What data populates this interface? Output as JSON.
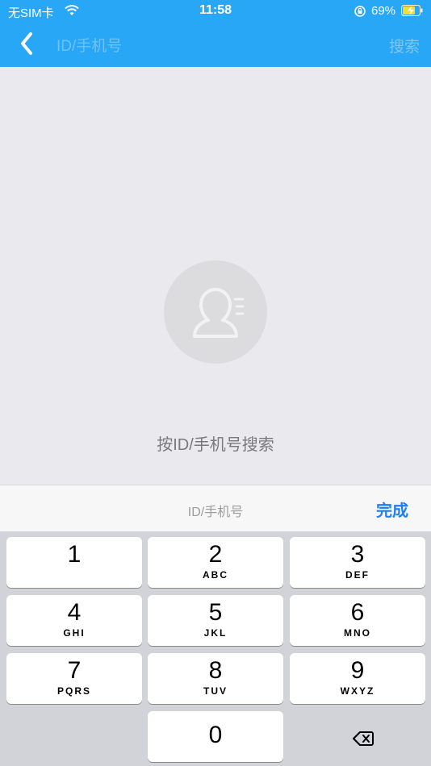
{
  "status_bar": {
    "carrier": "无SIM卡",
    "time": "11:58",
    "battery_percent": "69%"
  },
  "nav": {
    "search_placeholder": "ID/手机号",
    "search_button": "搜索"
  },
  "empty_state": {
    "hint": "按ID/手机号搜索"
  },
  "keyboard_accessory": {
    "placeholder": "ID/手机号",
    "done": "完成"
  },
  "keypad": {
    "keys": [
      {
        "num": "1",
        "letters": ""
      },
      {
        "num": "2",
        "letters": "ABC"
      },
      {
        "num": "3",
        "letters": "DEF"
      },
      {
        "num": "4",
        "letters": "GHI"
      },
      {
        "num": "5",
        "letters": "JKL"
      },
      {
        "num": "6",
        "letters": "MNO"
      },
      {
        "num": "7",
        "letters": "PQRS"
      },
      {
        "num": "8",
        "letters": "TUV"
      },
      {
        "num": "9",
        "letters": "WXYZ"
      },
      {
        "num": "0",
        "letters": ""
      }
    ]
  },
  "colors": {
    "header": "#28a7f6",
    "accent": "#1e7ff0"
  },
  "icons": [
    "wifi-icon",
    "orientation-lock-icon",
    "battery-charging-icon",
    "back-chevron-icon",
    "contact-avatar-icon",
    "delete-backspace-icon"
  ]
}
